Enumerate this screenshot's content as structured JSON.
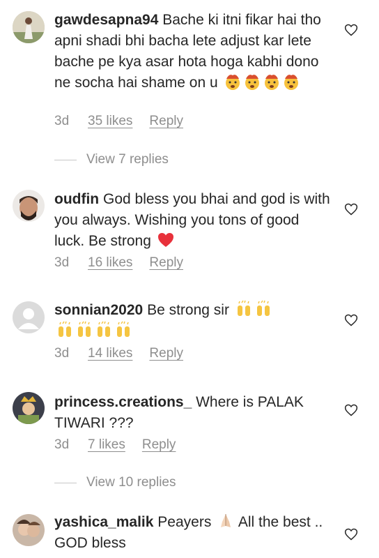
{
  "comments": [
    {
      "username": "gawdesapna94",
      "text": "Bache ki itni fikar hai tho apni shadi bhi bacha lete adjust kar lete bache pe kya asar hota hoga kabhi dono ne socha hai shame on u",
      "emojis": [
        "exploding-head-emoji",
        "exploding-head-emoji",
        "exploding-head-emoji",
        "exploding-head-emoji"
      ],
      "time": "3d",
      "likes": "35 likes",
      "reply": "Reply",
      "view_replies": "View 7 replies"
    },
    {
      "username": "oudfin",
      "text": "God bless you bhai and god is with you always.  Wishing you tons of good luck.  Be strong",
      "emojis": [
        "red-heart-emoji"
      ],
      "time": "3d",
      "likes": "16 likes",
      "reply": "Reply"
    },
    {
      "username": "sonnian2020",
      "text": "Be strong sir",
      "emojis": [
        "raised-hands-emoji",
        "raised-hands-emoji",
        "raised-hands-emoji",
        "raised-hands-emoji",
        "raised-hands-emoji",
        "raised-hands-emoji"
      ],
      "time": "3d",
      "likes": "14 likes",
      "reply": "Reply"
    },
    {
      "username": "princess.creations_",
      "text": "Where is PALAK TIWARI ???",
      "time": "3d",
      "likes": "7 likes",
      "reply": "Reply",
      "view_replies": "View 10 replies"
    },
    {
      "username": "yashica_malik",
      "text_a": "Peayers",
      "emojis": [
        "folded-hands-emoji"
      ],
      "text_b": "All the best .. GOD bless"
    }
  ],
  "colors": {
    "text": "#262626",
    "muted": "#8e8e8e",
    "heart_red": "#e0245e"
  }
}
